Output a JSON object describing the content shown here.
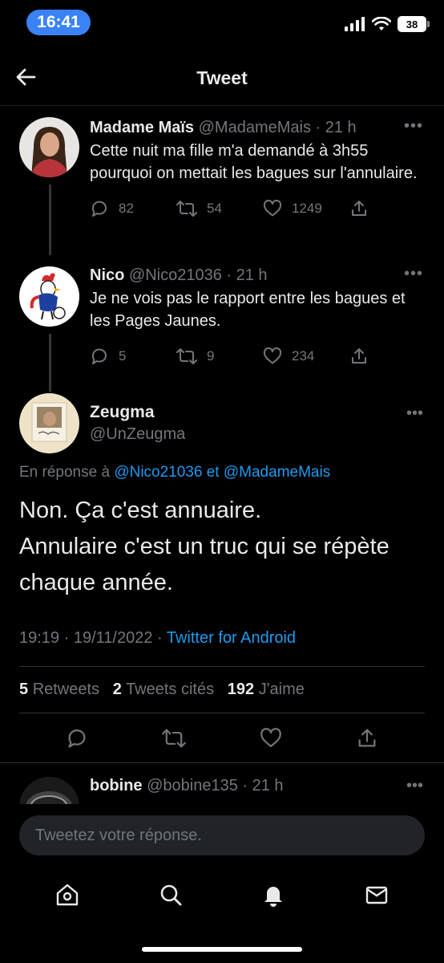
{
  "status_bar": {
    "time": "16:41",
    "battery": "38"
  },
  "header": {
    "title": "Tweet"
  },
  "tweets": [
    {
      "name": "Madame Maïs",
      "handle": "@MadameMais",
      "time": "· 21 h",
      "text": "Cette nuit ma fille m'a demandé à 3h55 pourquoi on mettait les bagues sur l'annulaire.",
      "replies": "82",
      "retweets": "54",
      "likes": "1249"
    },
    {
      "name": "Nico",
      "handle": "@Nico21036",
      "time": "· 21 h",
      "text": "Je ne vois pas le rapport entre les bagues et les Pages Jaunes.",
      "replies": "5",
      "retweets": "9",
      "likes": "234"
    }
  ],
  "main_tweet": {
    "name": "Zeugma",
    "handle": "@UnZeugma",
    "reply_prefix": "En réponse à",
    "reply_user1": "@Nico21036",
    "reply_and": "et",
    "reply_user2": "@MadameMais",
    "text_line1": "Non. Ça c'est annuaire.",
    "text_line2": "Annulaire c'est un truc qui se répète chaque année.",
    "timestamp": "19:19 · 19/11/2022 ·",
    "source": "Twitter for Android",
    "retweet_count": "5",
    "retweet_label": "Retweets",
    "quote_count": "2",
    "quote_label": "Tweets cités",
    "like_count": "192",
    "like_label": "J'aime"
  },
  "next_reply": {
    "name": "bobine",
    "handle": "@bobine135",
    "time": "· 21 h"
  },
  "reply_input": {
    "placeholder": "Tweetez votre réponse."
  },
  "nav": [
    "home",
    "search",
    "notifications",
    "messages"
  ],
  "colors": {
    "accent": "#1d9bf0",
    "background": "#000000",
    "secondary_text": "#71767b"
  }
}
